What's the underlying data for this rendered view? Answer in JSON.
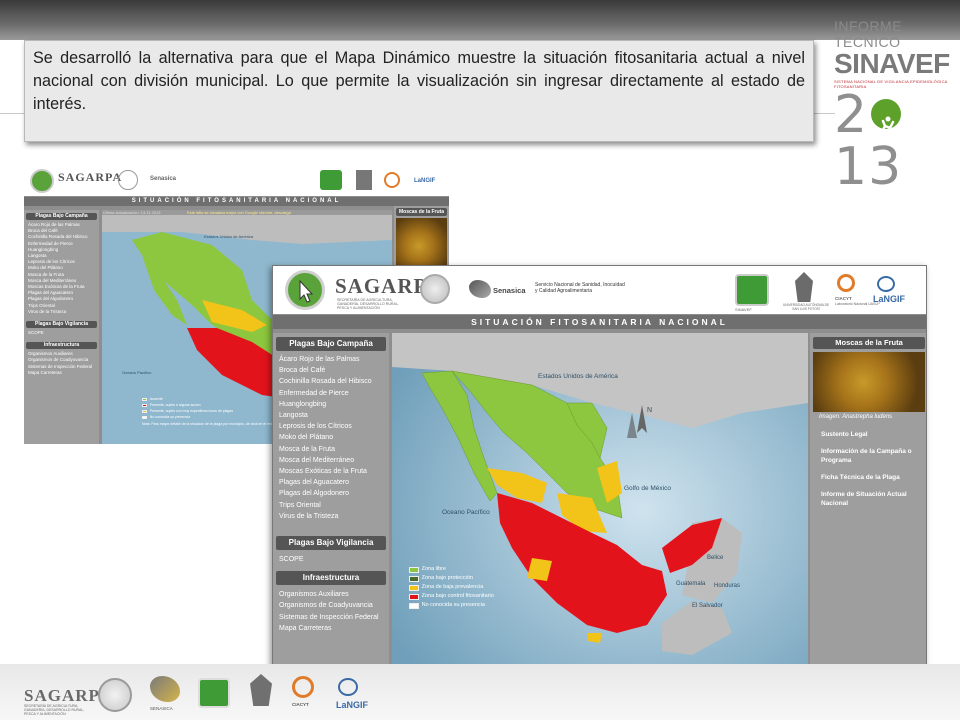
{
  "brand": {
    "line1": "INFORME TECNICO",
    "line2": "SINAVEF",
    "tagline": "SISTEMA NACIONAL DE VIGILANCIA EPIDEMIOLÓGICA FITOSANITARIA",
    "year_prefix": "2",
    "year_suffix": "13"
  },
  "slide_text": "Se desarrolló la alternativa para que el Mapa Dinámico muestre la situación fitosanitaria actual a nivel nacional con división municipal. Lo que permite la visualización  sin ingresar directamente al estado de interés.",
  "colors": {
    "libre": "#8dc63f",
    "proteccion": "#4a6b2a",
    "baja_prevalencia": "#f2c318",
    "control": "#e3131c",
    "no_conocida": "#ffffff",
    "water": "#8fb8cf",
    "land_gray": "#bdbdbd"
  },
  "app": {
    "logo": "SAGARPA",
    "logo_sub": "SECRETARÍA DE AGRICULTURA, GANADERÍA, DESARROLLO RURAL, PESCA Y ALIMENTACIÓN",
    "senasica": "Senasica",
    "senasica_sub": "Servicio Nacional de Sanidad, Inocuidad y Calidad Agroalimentaria",
    "sinavef": "SINAVEF",
    "uaslp": "UNIVERSIDAD AUTÓNOMA DE SAN LUIS POTOSÍ",
    "ciacyt": "CIACYT",
    "ciacyt_sub": "Laboratorio Nacional UASLP",
    "langif": "LaNGIF",
    "banner": "SITUACIÓN FITOSANITARIA NACIONAL",
    "section_campaign": "Plagas Bajo Campaña",
    "campaign_items": [
      "Ácaro Rojo de las Palmas",
      "Broca del Café",
      "Cochinilla Rosada del Hibisco",
      "Enfermedad de Pierce",
      "Huanglongbing",
      "Langosta",
      "Leprosis de los Cítricos",
      "Moko del Plátano",
      "Mosca de la Fruta",
      "Mosca del Mediterráneo",
      "Moscas Exóticas de la Fruta",
      "Plagas del Aguacatero",
      "Plagas del Algodonero",
      "Trips Oriental",
      "Virus de la Tristeza"
    ],
    "section_surveillance": "Plagas Bajo Vigilancia",
    "surveillance_items": [
      "SCOPE"
    ],
    "section_infra": "Infraestructura",
    "infra_items": [
      "Organismos Auxiliares",
      "Organismos de Coadyuvancia",
      "Sistemas de Inspección Federal",
      "Mapa Carreteras"
    ],
    "right_title": "Moscas de la Fruta",
    "image_caption": "Imagen: Anastrepha ludens",
    "right_links": [
      "Sustento Legal",
      "Información de la Campaña o Programa",
      "Ficha Técnica de la Plaga",
      "Informe de Situación Actual Nacional"
    ],
    "map_labels": {
      "usa": "Estados Unidos de América",
      "gulf": "Golfo de México",
      "pacific": "Oceano Pacífico",
      "belize": "Belice",
      "honduras": "Honduras",
      "guatemala": "Guatemala",
      "salvador": "El Salvador"
    },
    "legend": [
      {
        "label": "Zona libre",
        "color": "#8dc63f"
      },
      {
        "label": "Zona bajo protección",
        "color": "#4a6b2a"
      },
      {
        "label": "Zona de baja prevalencia",
        "color": "#f2c318"
      },
      {
        "label": "Zona bajo control fitosanitario",
        "color": "#e3131c"
      },
      {
        "label": "No conocida su presencia",
        "color": "#ffffff"
      }
    ],
    "back_date_label": "Última actualización: 14.11.2013",
    "back_notice": "Este sitio se visualiza mejor con Google chrome, descarga",
    "back_legend": [
      {
        "label": "Ausente",
        "color": "#8dc63f"
      },
      {
        "label": "Presente, sujeto a alguna accion",
        "color": "#e3131c"
      },
      {
        "label": "Presente, sujeto con muy especificas focos de plagas",
        "color": "#f2c318"
      },
      {
        "label": "No conocida su presencia",
        "color": "#ffffff"
      }
    ],
    "back_note": "Nota: Para mayor detalle de la situación de la plaga por municipio, de click en el estado."
  },
  "footer": {
    "sagarpa": "SAGARPA",
    "sagarpa_sub": "SECRETARÍA DE AGRICULTURA, GANADERÍA, DESARROLLO RURAL, PESCA Y ALIMENTACIÓN",
    "senasica": "SENASICA",
    "ciacyt": "CIACYT",
    "langif": "LaNGIF"
  }
}
